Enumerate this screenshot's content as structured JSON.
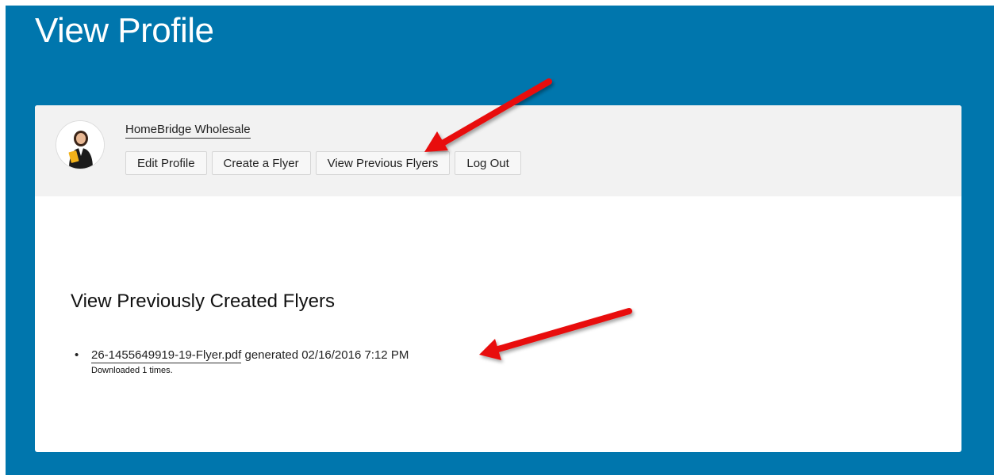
{
  "page": {
    "title": "View Profile"
  },
  "profile": {
    "company_name": "HomeBridge Wholesale",
    "avatar_icon": "user-avatar-icon"
  },
  "nav_buttons": {
    "edit_profile": "Edit Profile",
    "create_flyer": "Create a Flyer",
    "view_previous_flyers": "View Previous Flyers",
    "log_out": "Log Out"
  },
  "flyers_section": {
    "title": "View Previously Created Flyers",
    "items": [
      {
        "filename": "26-1455649919-19-Flyer.pdf",
        "generated_text": "generated 02/16/2016 7:12 PM",
        "downloads_text": "Downloaded 1 times."
      }
    ]
  },
  "colors": {
    "brand_blue": "#0076ad",
    "header_gray": "#f2f2f2",
    "annotation_red": "#e8110f"
  }
}
